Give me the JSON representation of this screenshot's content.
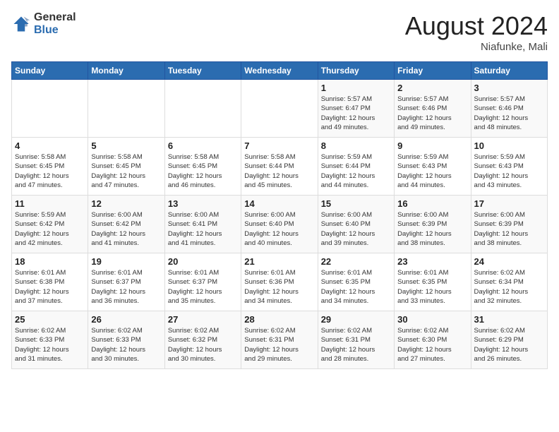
{
  "header": {
    "logo_general": "General",
    "logo_blue": "Blue",
    "month_year": "August 2024",
    "location": "Niafunke, Mali"
  },
  "days_of_week": [
    "Sunday",
    "Monday",
    "Tuesday",
    "Wednesday",
    "Thursday",
    "Friday",
    "Saturday"
  ],
  "weeks": [
    [
      {
        "day": "",
        "info": ""
      },
      {
        "day": "",
        "info": ""
      },
      {
        "day": "",
        "info": ""
      },
      {
        "day": "",
        "info": ""
      },
      {
        "day": "1",
        "info": "Sunrise: 5:57 AM\nSunset: 6:47 PM\nDaylight: 12 hours\nand 49 minutes."
      },
      {
        "day": "2",
        "info": "Sunrise: 5:57 AM\nSunset: 6:46 PM\nDaylight: 12 hours\nand 49 minutes."
      },
      {
        "day": "3",
        "info": "Sunrise: 5:57 AM\nSunset: 6:46 PM\nDaylight: 12 hours\nand 48 minutes."
      }
    ],
    [
      {
        "day": "4",
        "info": "Sunrise: 5:58 AM\nSunset: 6:45 PM\nDaylight: 12 hours\nand 47 minutes."
      },
      {
        "day": "5",
        "info": "Sunrise: 5:58 AM\nSunset: 6:45 PM\nDaylight: 12 hours\nand 47 minutes."
      },
      {
        "day": "6",
        "info": "Sunrise: 5:58 AM\nSunset: 6:45 PM\nDaylight: 12 hours\nand 46 minutes."
      },
      {
        "day": "7",
        "info": "Sunrise: 5:58 AM\nSunset: 6:44 PM\nDaylight: 12 hours\nand 45 minutes."
      },
      {
        "day": "8",
        "info": "Sunrise: 5:59 AM\nSunset: 6:44 PM\nDaylight: 12 hours\nand 44 minutes."
      },
      {
        "day": "9",
        "info": "Sunrise: 5:59 AM\nSunset: 6:43 PM\nDaylight: 12 hours\nand 44 minutes."
      },
      {
        "day": "10",
        "info": "Sunrise: 5:59 AM\nSunset: 6:43 PM\nDaylight: 12 hours\nand 43 minutes."
      }
    ],
    [
      {
        "day": "11",
        "info": "Sunrise: 5:59 AM\nSunset: 6:42 PM\nDaylight: 12 hours\nand 42 minutes."
      },
      {
        "day": "12",
        "info": "Sunrise: 6:00 AM\nSunset: 6:42 PM\nDaylight: 12 hours\nand 41 minutes."
      },
      {
        "day": "13",
        "info": "Sunrise: 6:00 AM\nSunset: 6:41 PM\nDaylight: 12 hours\nand 41 minutes."
      },
      {
        "day": "14",
        "info": "Sunrise: 6:00 AM\nSunset: 6:40 PM\nDaylight: 12 hours\nand 40 minutes."
      },
      {
        "day": "15",
        "info": "Sunrise: 6:00 AM\nSunset: 6:40 PM\nDaylight: 12 hours\nand 39 minutes."
      },
      {
        "day": "16",
        "info": "Sunrise: 6:00 AM\nSunset: 6:39 PM\nDaylight: 12 hours\nand 38 minutes."
      },
      {
        "day": "17",
        "info": "Sunrise: 6:00 AM\nSunset: 6:39 PM\nDaylight: 12 hours\nand 38 minutes."
      }
    ],
    [
      {
        "day": "18",
        "info": "Sunrise: 6:01 AM\nSunset: 6:38 PM\nDaylight: 12 hours\nand 37 minutes."
      },
      {
        "day": "19",
        "info": "Sunrise: 6:01 AM\nSunset: 6:37 PM\nDaylight: 12 hours\nand 36 minutes."
      },
      {
        "day": "20",
        "info": "Sunrise: 6:01 AM\nSunset: 6:37 PM\nDaylight: 12 hours\nand 35 minutes."
      },
      {
        "day": "21",
        "info": "Sunrise: 6:01 AM\nSunset: 6:36 PM\nDaylight: 12 hours\nand 34 minutes."
      },
      {
        "day": "22",
        "info": "Sunrise: 6:01 AM\nSunset: 6:35 PM\nDaylight: 12 hours\nand 34 minutes."
      },
      {
        "day": "23",
        "info": "Sunrise: 6:01 AM\nSunset: 6:35 PM\nDaylight: 12 hours\nand 33 minutes."
      },
      {
        "day": "24",
        "info": "Sunrise: 6:02 AM\nSunset: 6:34 PM\nDaylight: 12 hours\nand 32 minutes."
      }
    ],
    [
      {
        "day": "25",
        "info": "Sunrise: 6:02 AM\nSunset: 6:33 PM\nDaylight: 12 hours\nand 31 minutes."
      },
      {
        "day": "26",
        "info": "Sunrise: 6:02 AM\nSunset: 6:33 PM\nDaylight: 12 hours\nand 30 minutes."
      },
      {
        "day": "27",
        "info": "Sunrise: 6:02 AM\nSunset: 6:32 PM\nDaylight: 12 hours\nand 30 minutes."
      },
      {
        "day": "28",
        "info": "Sunrise: 6:02 AM\nSunset: 6:31 PM\nDaylight: 12 hours\nand 29 minutes."
      },
      {
        "day": "29",
        "info": "Sunrise: 6:02 AM\nSunset: 6:31 PM\nDaylight: 12 hours\nand 28 minutes."
      },
      {
        "day": "30",
        "info": "Sunrise: 6:02 AM\nSunset: 6:30 PM\nDaylight: 12 hours\nand 27 minutes."
      },
      {
        "day": "31",
        "info": "Sunrise: 6:02 AM\nSunset: 6:29 PM\nDaylight: 12 hours\nand 26 minutes."
      }
    ]
  ]
}
